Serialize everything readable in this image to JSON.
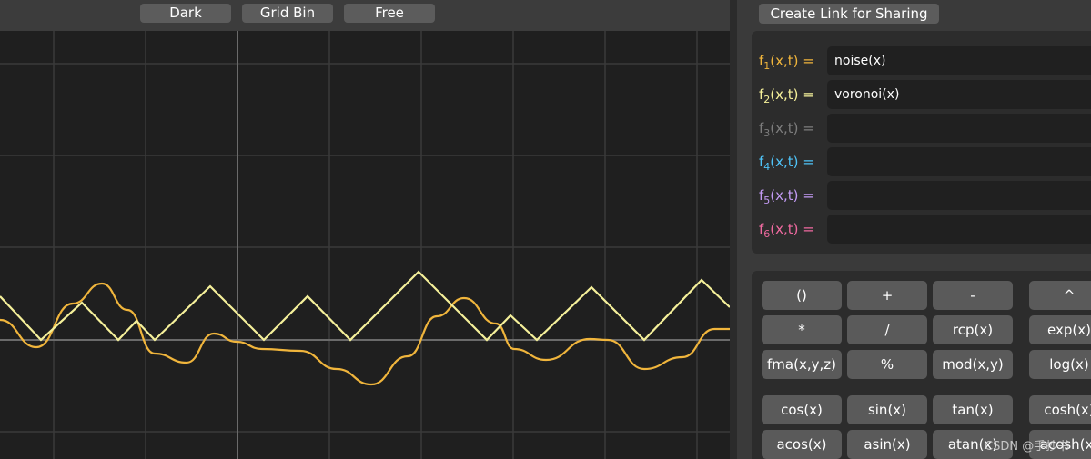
{
  "toolbar": {
    "buttons": [
      "Dark",
      "Grid Bin",
      "Free"
    ]
  },
  "share": {
    "label": "Create Link for Sharing"
  },
  "functions": [
    {
      "name": "f",
      "sub": "1",
      "args": "(x,t) =",
      "value": "noise(x)",
      "color": "#f0b53c"
    },
    {
      "name": "f",
      "sub": "2",
      "args": "(x,t) =",
      "value": "voronoi(x)",
      "color": "#f5f09a"
    },
    {
      "name": "f",
      "sub": "3",
      "args": "(x,t) =",
      "value": "",
      "color": "#7d7d7d"
    },
    {
      "name": "f",
      "sub": "4",
      "args": "(x,t) =",
      "value": "",
      "color": "#4fc3f7"
    },
    {
      "name": "f",
      "sub": "5",
      "args": "(x,t) =",
      "value": "",
      "color": "#c39bf5"
    },
    {
      "name": "f",
      "sub": "6",
      "args": "(x,t) =",
      "value": "",
      "color": "#f06aa0"
    }
  ],
  "keypad": {
    "row1": [
      "()",
      "+",
      "-",
      "^"
    ],
    "row2": [
      "*",
      "/",
      "rcp(x)",
      "exp(x)"
    ],
    "row3": [
      "fma(x,y,z)",
      "%",
      "mod(x,y)",
      "log(x)"
    ],
    "row4": [
      "cos(x)",
      "sin(x)",
      "tan(x)",
      "cosh(x)"
    ],
    "row5": [
      "acos(x)",
      "asin(x)",
      "atan(x)",
      "acosh(x)"
    ]
  },
  "colors": {
    "noise": "#f0b53c",
    "voronoi": "#f5f09a",
    "background": "#1f1f1f",
    "grid": "#3a3a3a",
    "axis": "#6a6a6a"
  },
  "watermark": "CSDN @手抄书"
}
